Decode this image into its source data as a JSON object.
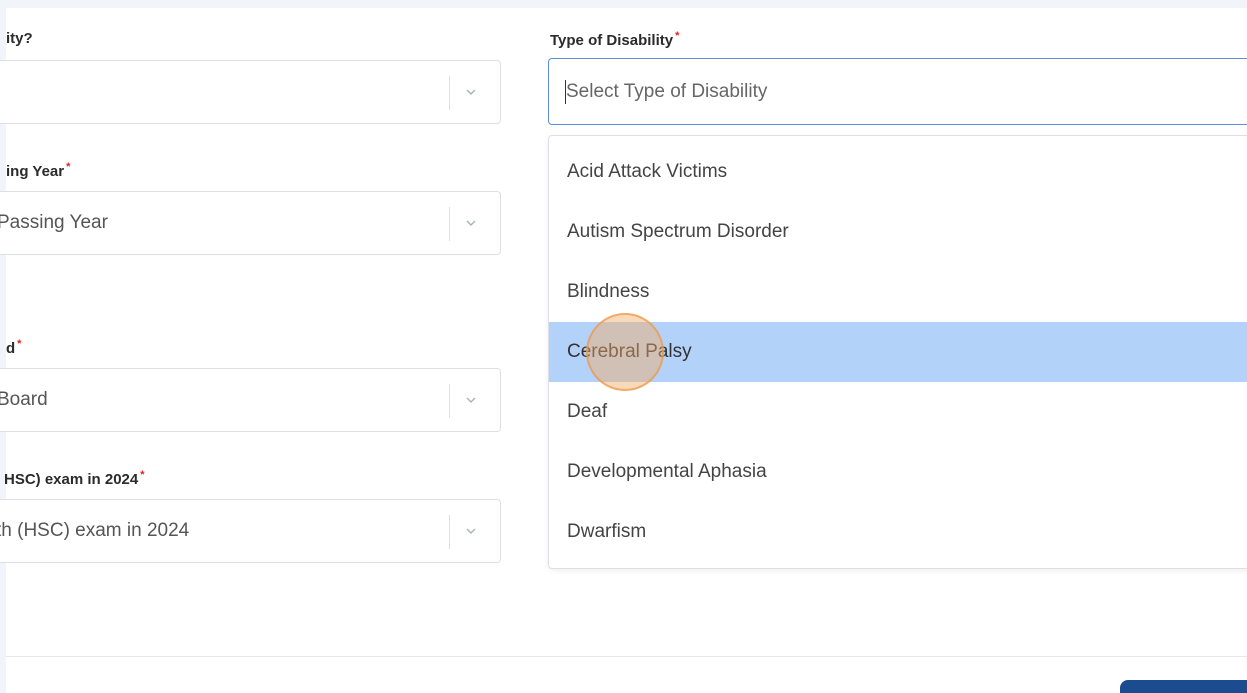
{
  "fields": [
    {
      "label": "ity?",
      "value": ""
    },
    {
      "label": "ing Year",
      "required": true,
      "value": "Passing Year"
    },
    {
      "label": "d",
      "required": true,
      "value": "Board"
    },
    {
      "label": "HSC) exam in 2024",
      "required": true,
      "value": "th (HSC) exam in 2024"
    }
  ],
  "disability": {
    "label": "Type of Disability",
    "required": true,
    "placeholder": "Select Type of Disability",
    "options": [
      "Acid Attack Victims",
      "Autism Spectrum Disorder",
      "Blindness",
      "Cerebral Palsy",
      "Deaf",
      "Developmental Aphasia",
      "Dwarfism"
    ],
    "highlighted": "Cerebral Palsy"
  },
  "required_mark": "*",
  "colors": {
    "highlight": "#b3d2fa",
    "focus_border": "#5b8fd6",
    "required": "#e02020",
    "primary_button": "#1a4c8f"
  }
}
